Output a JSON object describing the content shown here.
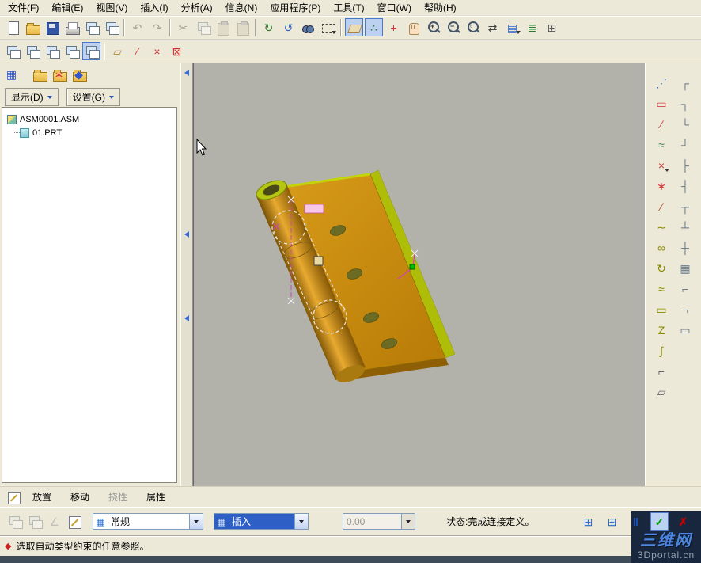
{
  "menubar": {
    "items": [
      {
        "label": "文件(F)"
      },
      {
        "label": "编辑(E)"
      },
      {
        "label": "视图(V)"
      },
      {
        "label": "插入(I)"
      },
      {
        "label": "分析(A)"
      },
      {
        "label": "信息(N)"
      },
      {
        "label": "应用程序(P)"
      },
      {
        "label": "工具(T)"
      },
      {
        "label": "窗口(W)"
      },
      {
        "label": "帮助(H)"
      }
    ]
  },
  "toolbar_main": {
    "g1": [
      {
        "name": "new-file-icon",
        "cls": "i-page"
      },
      {
        "name": "open-file-icon",
        "cls": "i-folder"
      },
      {
        "name": "save-icon",
        "cls": "i-floppy"
      },
      {
        "name": "print-icon",
        "cls": "i-printer"
      },
      {
        "name": "erase-display-icon",
        "cls": "i-win"
      },
      {
        "name": "delete-old-versions-icon",
        "cls": "i-win"
      }
    ],
    "g2": [
      {
        "name": "undo-icon",
        "glyph": "↶",
        "disabled": true
      },
      {
        "name": "redo-icon",
        "glyph": "↷",
        "disabled": true
      }
    ],
    "g3": [
      {
        "name": "cut-icon",
        "glyph": "✂",
        "disabled": true
      },
      {
        "name": "copy-icon",
        "cls": "i-win",
        "disabled": true
      },
      {
        "name": "paste-icon",
        "cls": "i-paste",
        "disabled": true
      },
      {
        "name": "paste-special-icon",
        "cls": "i-paste",
        "disabled": true
      }
    ],
    "g4": [
      {
        "name": "regenerate-icon",
        "glyph": "↻",
        "color": "#2a7a2a"
      },
      {
        "name": "auto-regenerate-icon",
        "glyph": "↺",
        "color": "#2a66c8"
      },
      {
        "name": "find-icon",
        "cls": "i-binoc"
      },
      {
        "name": "selection-filter-icon",
        "cls": "i-dashrect",
        "witharrow": true
      }
    ],
    "g5": [
      {
        "name": "datum-display-toggle-icon",
        "cls": "i-plane",
        "pressed": true
      },
      {
        "name": "point-display-toggle-icon",
        "glyph": "∴",
        "color": "#2a7a2a",
        "pressed": true
      },
      {
        "name": "spin-center-icon",
        "glyph": "+",
        "color": "#cc3333"
      },
      {
        "name": "pan-icon",
        "cls": "i-hand"
      },
      {
        "name": "zoom-in-icon",
        "cls": "i-zoom",
        "glyph": "+",
        "color": "#333333"
      },
      {
        "name": "zoom-out-icon",
        "cls": "i-zoom",
        "glyph": "−",
        "color": "#333333"
      },
      {
        "name": "zoom-fit-icon",
        "cls": "i-zoom",
        "glyph": "▫",
        "color": "#333333"
      },
      {
        "name": "reorient-icon",
        "glyph": "⇄",
        "color": "#444444"
      },
      {
        "name": "saved-views-icon",
        "glyph": "▤",
        "color": "#2a66c8",
        "witharrow": true
      },
      {
        "name": "layers-icon",
        "glyph": "≣",
        "color": "#2a7a2a"
      },
      {
        "name": "view-manager-icon",
        "glyph": "⊞",
        "color": "#555555"
      }
    ]
  },
  "toolbar_second": {
    "wins": [
      {
        "name": "new-window-icon",
        "cls": "i-win"
      },
      {
        "name": "tile-window-icon",
        "cls": "i-win"
      },
      {
        "name": "cascade-window-icon",
        "cls": "i-win"
      },
      {
        "name": "close-window-icon",
        "cls": "i-win"
      },
      {
        "name": "active-window-icon",
        "cls": "i-win",
        "pressed": true
      }
    ],
    "datum_tags": [
      {
        "name": "plane-tag-toggle-icon",
        "glyph": "▱",
        "color": "#b8863a"
      },
      {
        "name": "axis-tag-toggle-icon",
        "glyph": "∕",
        "color": "#cc3333"
      },
      {
        "name": "point-tag-toggle-icon",
        "glyph": "×",
        "color": "#cc3333"
      },
      {
        "name": "csys-tag-toggle-icon",
        "glyph": "⊠",
        "color": "#cc3333"
      }
    ]
  },
  "left_toolbar": {
    "primary": [
      {
        "name": "tree-columns-icon",
        "glyph": "▦",
        "color": "#3355cc"
      }
    ],
    "folders": [
      {
        "name": "tree-show-folder-icon",
        "cls": "i-folder"
      },
      {
        "name": "tree-search-folder-icon",
        "cls": "i-folder",
        "glyph": "∗",
        "color": "#cc3333"
      },
      {
        "name": "tree-settings-folder-icon",
        "cls": "i-folder",
        "glyph": "◆",
        "color": "#3355cc"
      }
    ]
  },
  "tree_panel": {
    "display_button": "显示(D)",
    "settings_button": "设置(G)",
    "nodes": [
      {
        "label": "ASM0001.ASM",
        "cls": "root asm"
      },
      {
        "label": "01.PRT",
        "cls": "child prt"
      }
    ]
  },
  "right_toolbar": {
    "col1": [
      {
        "name": "snap-settings-icon",
        "glyph": "⋰",
        "color": "#3366cc"
      },
      {
        "name": "datum-plane-tool-icon",
        "glyph": "▭",
        "color": "#cc4444"
      },
      {
        "name": "datum-axis-tool-icon",
        "glyph": "∕",
        "color": "#cc4444"
      },
      {
        "name": "curve-tool-icon",
        "glyph": "≈",
        "color": "#3a8a5a"
      },
      {
        "name": "datum-point-tool-icon",
        "glyph": "×",
        "color": "#cc3333",
        "witharrow": true
      },
      {
        "name": "point-array-tool-icon",
        "glyph": "∗",
        "color": "#cc3333"
      },
      {
        "name": "sketched-axis-tool-icon",
        "glyph": "∕",
        "color": "#bb5533"
      },
      {
        "name": "use-edge-tool-icon",
        "glyph": "∼",
        "color": "#8a8a00"
      },
      {
        "name": "circle-tool-icon",
        "glyph": "∞",
        "color": "#8a8a00"
      },
      {
        "name": "revolve-tool-icon",
        "glyph": "↻",
        "color": "#8a8a00"
      },
      {
        "name": "spline-tool-icon",
        "glyph": "≈",
        "color": "#8a8a00"
      },
      {
        "name": "rectangle-tool-icon",
        "glyph": "▭",
        "color": "#8a8a00"
      },
      {
        "name": "zigzag-tool-icon",
        "glyph": "Z",
        "color": "#8a8a00"
      },
      {
        "name": "sweep-tool-icon",
        "glyph": "∫",
        "color": "#8a8a00"
      },
      {
        "name": "corner-tool-icon",
        "glyph": "⌐",
        "color": "#666677"
      },
      {
        "name": "flatten-tool-icon",
        "glyph": "▱",
        "color": "#666677"
      }
    ],
    "col2": [
      {
        "name": "side-tool-icon-1",
        "glyph": "┌",
        "color": "#667788"
      },
      {
        "name": "side-tool-icon-2",
        "glyph": "┐",
        "color": "#667788"
      },
      {
        "name": "side-tool-icon-3",
        "glyph": "└",
        "color": "#667788"
      },
      {
        "name": "side-tool-icon-4",
        "glyph": "┘",
        "color": "#667788"
      },
      {
        "name": "side-tool-icon-5",
        "glyph": "├",
        "color": "#667788"
      },
      {
        "name": "side-tool-icon-6",
        "glyph": "┤",
        "color": "#667788"
      },
      {
        "name": "side-tool-icon-7",
        "glyph": "┬",
        "color": "#667788"
      },
      {
        "name": "side-tool-icon-8",
        "glyph": "┴",
        "color": "#667788"
      },
      {
        "name": "side-tool-icon-9",
        "glyph": "┼",
        "color": "#667788"
      },
      {
        "name": "side-tool-icon-10",
        "glyph": "▦",
        "color": "#667788"
      },
      {
        "name": "side-tool-icon-11",
        "glyph": "⌐",
        "color": "#667788"
      },
      {
        "name": "side-tool-icon-12",
        "glyph": "¬",
        "color": "#667788"
      },
      {
        "name": "side-tool-icon-13",
        "glyph": "▭",
        "color": "#667788"
      }
    ]
  },
  "bottom_tabs": {
    "items": [
      {
        "label": "放置",
        "name": "tab-placement"
      },
      {
        "label": "移动",
        "name": "tab-move"
      },
      {
        "label": "挠性",
        "name": "tab-flexibility",
        "enabled": false
      },
      {
        "label": "属性",
        "name": "tab-properties"
      }
    ]
  },
  "dashboard": {
    "left_icons": [
      {
        "name": "open-subwindow-icon",
        "cls": "i-win",
        "disabled": true
      },
      {
        "name": "freeze-component-icon",
        "cls": "i-win",
        "disabled": true
      },
      {
        "name": "constraint-list-icon",
        "glyph": "∠",
        "color": "#888888",
        "disabled": true
      },
      {
        "name": "define-placement-icon",
        "cls": "i-sketchbtn"
      }
    ],
    "mode_combo": {
      "icon_glyph": "▦",
      "value": "常规"
    },
    "insert_combo": {
      "icon_glyph": "▦",
      "value": "插入"
    },
    "offset_field": {
      "value": "0.00"
    },
    "status": "状态:完成连接定义。",
    "right_icons": [
      {
        "name": "component-window-icon",
        "glyph": "⊞",
        "color": "#2a6ac8"
      },
      {
        "name": "assembly-window-icon",
        "glyph": "⊞",
        "color": "#2a6ac8"
      },
      {
        "name": "pause-icon",
        "glyph": "‖",
        "color": "#2255cc",
        "cls": "big"
      },
      {
        "name": "ok-icon",
        "glyph": "✓",
        "color": "#00a000",
        "cls": "big",
        "pressed": true
      },
      {
        "name": "cancel-icon",
        "glyph": "✗",
        "color": "#cc0000",
        "cls": "big"
      }
    ]
  },
  "statusbar": {
    "icon_glyph": "◆",
    "message": "选取自动类型约束的任意参照。"
  },
  "watermark": {
    "title": "三维网",
    "subtitle": "3Dportal.cn"
  },
  "viewport": {
    "background": "#b2b2aa",
    "part_color": "#c8880c",
    "edge_highlight": "#b6c612",
    "hole_color": "#6b6b23",
    "constraint_color": "#d040c0"
  }
}
